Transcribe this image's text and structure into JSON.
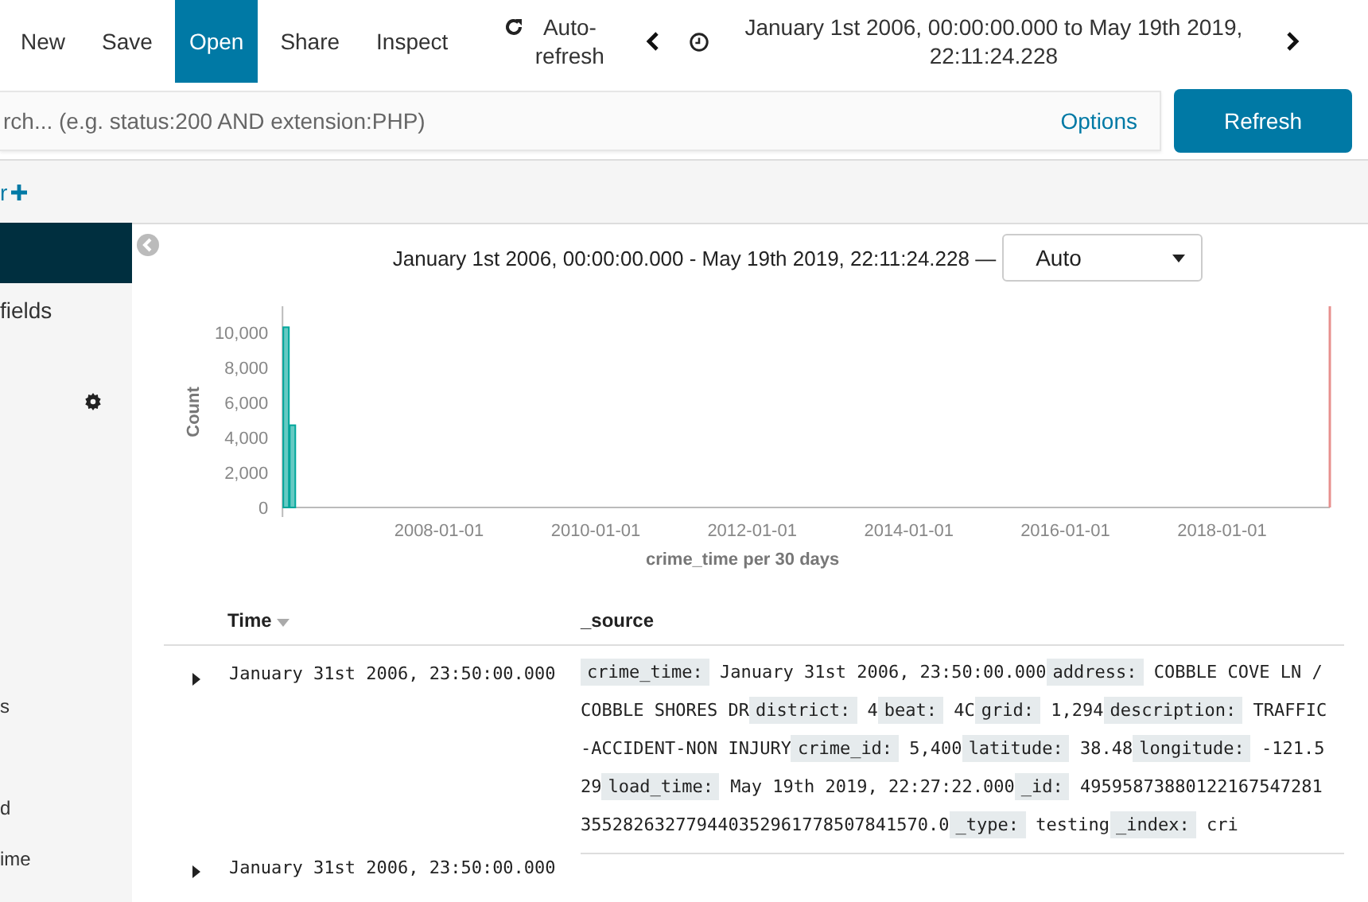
{
  "top_nav": {
    "items": [
      {
        "label": "New",
        "selected": false
      },
      {
        "label": "Save",
        "selected": false
      },
      {
        "label": "Open",
        "selected": true
      },
      {
        "label": "Share",
        "selected": false
      },
      {
        "label": "Inspect",
        "selected": false
      }
    ],
    "auto_refresh": "Auto-refresh",
    "time_range": "January 1st 2006, 00:00:00.000 to May 19th 2019, 22:11:24.228"
  },
  "query_bar": {
    "placeholder": "rch... (e.g. status:200 AND extension:PHP)",
    "options": "Options",
    "refresh": "Refresh"
  },
  "filter_bar": {
    "add_filter": "r"
  },
  "sidebar": {
    "fields_label": "fields",
    "items": [
      "s",
      "d",
      "ime"
    ]
  },
  "histogram": {
    "range_text": "January 1st 2006, 00:00:00.000 - May 19th 2019, 22:11:24.228 —",
    "interval": "Auto",
    "chart_data": {
      "type": "bar",
      "xlabel": "crime_time per 30 days",
      "ylabel": "Count",
      "x": [
        "2006-01-01",
        "2006-01-31"
      ],
      "series": [
        {
          "color": "#00a69b",
          "values": [
            10300,
            4700
          ]
        }
      ],
      "xlim": [
        "2006-01-01",
        "2019-05-19"
      ],
      "ylim": [
        0,
        11500
      ],
      "xticks": [
        "2008-01-01",
        "2010-01-01",
        "2012-01-01",
        "2014-01-01",
        "2016-01-01",
        "2018-01-01"
      ],
      "yticks": [
        {
          "value": 0,
          "label": "0"
        },
        {
          "value": 2000,
          "label": "2,000"
        },
        {
          "value": 4000,
          "label": "4,000"
        },
        {
          "value": 6000,
          "label": "6,000"
        },
        {
          "value": 8000,
          "label": "8,000"
        },
        {
          "value": 10000,
          "label": "10,000"
        }
      ]
    }
  },
  "table": {
    "columns": [
      "Time",
      "_source"
    ],
    "rows": [
      {
        "time": "January 31st 2006, 23:50:00.000",
        "source": [
          {
            "key": "crime_time:",
            "value": "January 31st 2006, 23:50:00.000"
          },
          {
            "key": "address:",
            "value": "COBBLE COVE LN / COBBLE SHORES DR"
          },
          {
            "key": "district:",
            "value": "4"
          },
          {
            "key": "beat:",
            "value": "4C"
          },
          {
            "key": "grid:",
            "value": "1,294"
          },
          {
            "key": "description:",
            "value": "TRAFFIC-ACCIDENT-NON INJURY"
          },
          {
            "key": "crime_id:",
            "value": "5,400"
          },
          {
            "key": "latitude:",
            "value": "38.48"
          },
          {
            "key": "longitude:",
            "value": "-121.529"
          },
          {
            "key": "load_time:",
            "value": "May 19th 2019, 22:27:22.000"
          },
          {
            "key": "_id:",
            "value": "49595873880122167547281355282632779440352961778507841570.0"
          },
          {
            "key": "_type:",
            "value": "testing"
          },
          {
            "key": "_index:",
            "value": "cri"
          }
        ]
      },
      {
        "time": "January 31st 2006, 23:50:00.000",
        "source": []
      }
    ]
  }
}
